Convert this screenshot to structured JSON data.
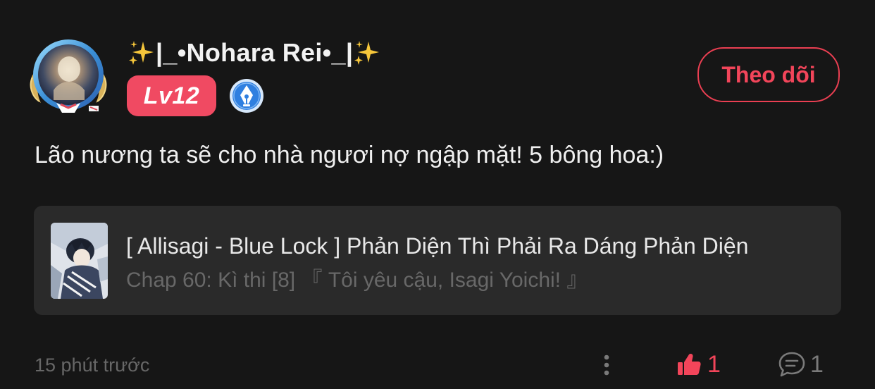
{
  "user": {
    "name": "|_•Nohara Rei•_|",
    "level": "Lv12",
    "avatar_icon": "angel-winged-avatar",
    "author_badge_icon": "pen-nib-icon"
  },
  "follow_button": {
    "label": "Theo dõi"
  },
  "comment": {
    "text": "Lão nương ta sẽ cho nhà ngươi nợ ngập mặt! 5 bông hoa:)"
  },
  "story": {
    "title": "[ Allisagi - Blue Lock ] Phản Diện Thì Phải Ra Dáng Phản Diện",
    "chapter": "Chap 60: Kì thi [8] 『 Tôi yêu cậu, Isagi Yoichi! 』"
  },
  "footer": {
    "timestamp": "15 phút trước",
    "like_count": "1",
    "comment_count": "1"
  },
  "colors": {
    "background": "#161616",
    "accent": "#f04a62",
    "card": "#2a2a2a",
    "muted_text": "#676767",
    "badge_blue": "#2f7fe0"
  }
}
